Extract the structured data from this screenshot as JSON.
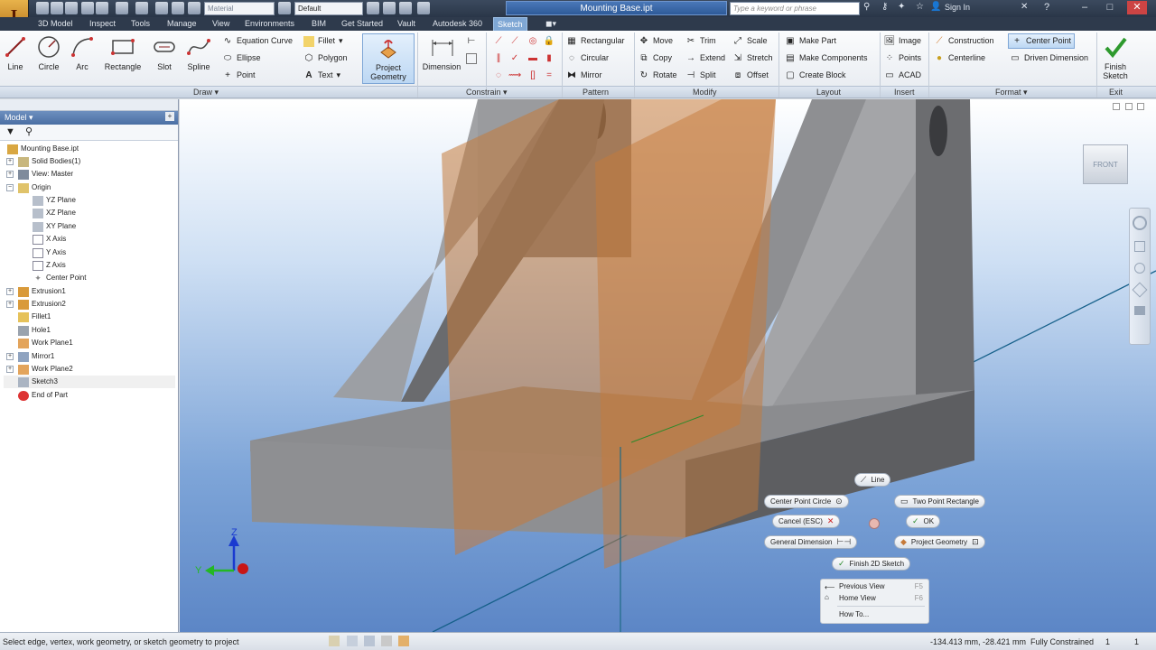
{
  "app": {
    "logo_letter": "I",
    "title": "Mounting Base.ipt"
  },
  "qat": {
    "material": "Material",
    "appearance": "Default"
  },
  "search": {
    "placeholder": "Type a keyword or phrase"
  },
  "user": {
    "signin": "Sign In"
  },
  "tabs": [
    "3D Model",
    "Inspect",
    "Tools",
    "Manage",
    "View",
    "Environments",
    "BIM",
    "Get Started",
    "Vault",
    "Autodesk 360",
    "Sketch"
  ],
  "ribbon": {
    "draw": {
      "line": "Line",
      "circle": "Circle",
      "arc": "Arc",
      "rectangle": "Rectangle",
      "slot": "Slot",
      "spline": "Spline",
      "equation_curve": "Equation Curve",
      "ellipse": "Ellipse",
      "point": "Point",
      "fillet": "Fillet",
      "polygon": "Polygon",
      "text": "Text",
      "project_geometry_1": "Project",
      "project_geometry_2": "Geometry"
    },
    "constrain": {
      "dimension": "Dimension"
    },
    "pattern": {
      "rectangular": "Rectangular",
      "circular": "Circular",
      "mirror": "Mirror"
    },
    "modify": {
      "move": "Move",
      "trim": "Trim",
      "scale": "Scale",
      "copy": "Copy",
      "extend": "Extend",
      "stretch": "Stretch",
      "rotate": "Rotate",
      "split": "Split",
      "offset": "Offset"
    },
    "layout": {
      "make_part": "Make Part",
      "make_components": "Make Components",
      "create_block": "Create Block"
    },
    "insert": {
      "image": "Image",
      "points": "Points",
      "acad": "ACAD"
    },
    "format": {
      "construction": "Construction",
      "center_point": "Center Point",
      "centerline": "Centerline",
      "driven_dimension": "Driven Dimension"
    },
    "exit": {
      "finish_1": "Finish",
      "finish_2": "Sketch"
    },
    "panels": {
      "draw": "Draw ▾",
      "constrain": "Constrain ▾",
      "pattern": "Pattern",
      "modify": "Modify",
      "layout": "Layout",
      "insert": "Insert",
      "format": "Format ▾",
      "exit": "Exit"
    }
  },
  "browser": {
    "title": "Model ▾",
    "tree": [
      "Mounting Base.ipt",
      "Solid Bodies(1)",
      "View: Master",
      "Origin",
      "YZ Plane",
      "XZ Plane",
      "XY Plane",
      "X Axis",
      "Y Axis",
      "Z Axis",
      "Center Point",
      "Extrusion1",
      "Extrusion2",
      "Fillet1",
      "Hole1",
      "Work Plane1",
      "Mirror1",
      "Work Plane2",
      "Sketch3",
      "End of Part"
    ]
  },
  "viewcube": {
    "face": "FRONT"
  },
  "triad": {
    "z": "Z",
    "y": "Y"
  },
  "marking_menu": {
    "line": "Line",
    "center_point_circle": "Center Point Circle",
    "two_point_rectangle": "Two Point Rectangle",
    "cancel": "Cancel (ESC)",
    "ok": "OK",
    "general_dimension": "General Dimension",
    "project_geometry": "Project Geometry",
    "finish_2d_sketch": "Finish 2D Sketch"
  },
  "context_menu": {
    "previous_view": "Previous View",
    "previous_view_shortcut": "F5",
    "home_view": "Home View",
    "home_view_shortcut": "F6",
    "how_to": "How To..."
  },
  "status": {
    "prompt": "Select edge, vertex, work geometry, or sketch geometry to project",
    "coords": "-134.413 mm, -28.421 mm",
    "constraint_state": "Fully Constrained",
    "count1": "1",
    "count2": "1"
  },
  "colors": {
    "accent": "#7fa7d4",
    "part_gray": "#8c8d90",
    "plane_orange": "#c8844a",
    "viewport_bottom": "#5c86c6"
  }
}
